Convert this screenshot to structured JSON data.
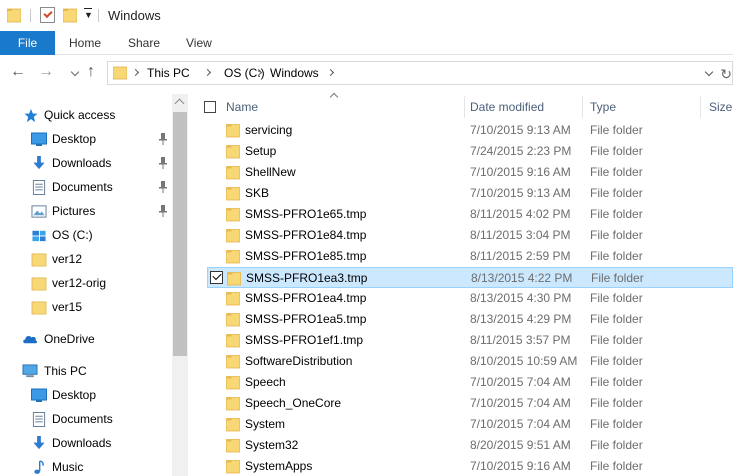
{
  "window": {
    "title": "Windows"
  },
  "ribbon": {
    "tabs": [
      {
        "label": "File",
        "active": true
      },
      {
        "label": "Home"
      },
      {
        "label": "Share"
      },
      {
        "label": "View"
      }
    ]
  },
  "address": {
    "crumbs": [
      "This PC",
      "OS (C:)",
      "Windows"
    ]
  },
  "nav_pane": {
    "items": [
      {
        "label": "Quick access",
        "icon": "star-icon"
      },
      {
        "label": "Desktop",
        "icon": "desktop-icon",
        "pinned": true
      },
      {
        "label": "Downloads",
        "icon": "downloads-icon",
        "pinned": true
      },
      {
        "label": "Documents",
        "icon": "documents-icon",
        "pinned": true
      },
      {
        "label": "Pictures",
        "icon": "pictures-icon",
        "pinned": true
      },
      {
        "label": "OS (C:)",
        "icon": "drive-icon"
      },
      {
        "label": "ver12",
        "icon": "folder-icon"
      },
      {
        "label": "ver12-orig",
        "icon": "folder-icon"
      },
      {
        "label": "ver15",
        "icon": "folder-icon"
      },
      {
        "label": "OneDrive",
        "icon": "cloud-icon"
      },
      {
        "label": "This PC",
        "icon": "computer-icon"
      },
      {
        "label": "Desktop",
        "icon": "desktop-icon"
      },
      {
        "label": "Documents",
        "icon": "documents-icon"
      },
      {
        "label": "Downloads",
        "icon": "downloads-icon"
      },
      {
        "label": "Music",
        "icon": "music-icon"
      }
    ]
  },
  "file_list": {
    "columns": [
      "Name",
      "Date modified",
      "Type",
      "Size"
    ],
    "rows": [
      {
        "name": "servicing",
        "date": "7/10/2015 9:13 AM",
        "type": "File folder"
      },
      {
        "name": "Setup",
        "date": "7/24/2015 2:23 PM",
        "type": "File folder"
      },
      {
        "name": "ShellNew",
        "date": "7/10/2015 9:16 AM",
        "type": "File folder"
      },
      {
        "name": "SKB",
        "date": "7/10/2015 9:13 AM",
        "type": "File folder"
      },
      {
        "name": "SMSS-PFRO1e65.tmp",
        "date": "8/11/2015 4:02 PM",
        "type": "File folder"
      },
      {
        "name": "SMSS-PFRO1e84.tmp",
        "date": "8/11/2015 3:04 PM",
        "type": "File folder"
      },
      {
        "name": "SMSS-PFRO1e85.tmp",
        "date": "8/11/2015 2:59 PM",
        "type": "File folder"
      },
      {
        "name": "SMSS-PFRO1ea3.tmp",
        "date": "8/13/2015 4:22 PM",
        "type": "File folder",
        "selected": true
      },
      {
        "name": "SMSS-PFRO1ea4.tmp",
        "date": "8/13/2015 4:30 PM",
        "type": "File folder"
      },
      {
        "name": "SMSS-PFRO1ea5.tmp",
        "date": "8/13/2015 4:29 PM",
        "type": "File folder"
      },
      {
        "name": "SMSS-PFRO1ef1.tmp",
        "date": "8/11/2015 3:57 PM",
        "type": "File folder"
      },
      {
        "name": "SoftwareDistribution",
        "date": "8/10/2015 10:59 AM",
        "type": "File folder"
      },
      {
        "name": "Speech",
        "date": "7/10/2015 7:04 AM",
        "type": "File folder"
      },
      {
        "name": "Speech_OneCore",
        "date": "7/10/2015 7:04 AM",
        "type": "File folder"
      },
      {
        "name": "System",
        "date": "7/10/2015 7:04 AM",
        "type": "File folder"
      },
      {
        "name": "System32",
        "date": "8/20/2015 9:51 AM",
        "type": "File folder"
      },
      {
        "name": "SystemApps",
        "date": "7/10/2015 9:16 AM",
        "type": "File folder"
      }
    ]
  },
  "colors": {
    "accent": "#1979ca",
    "folder": "#f8d775",
    "folder_dark": "#e8b74a",
    "selection": "#cce8ff",
    "selection_border": "#99d1ff",
    "header_text": "#4c607a"
  }
}
